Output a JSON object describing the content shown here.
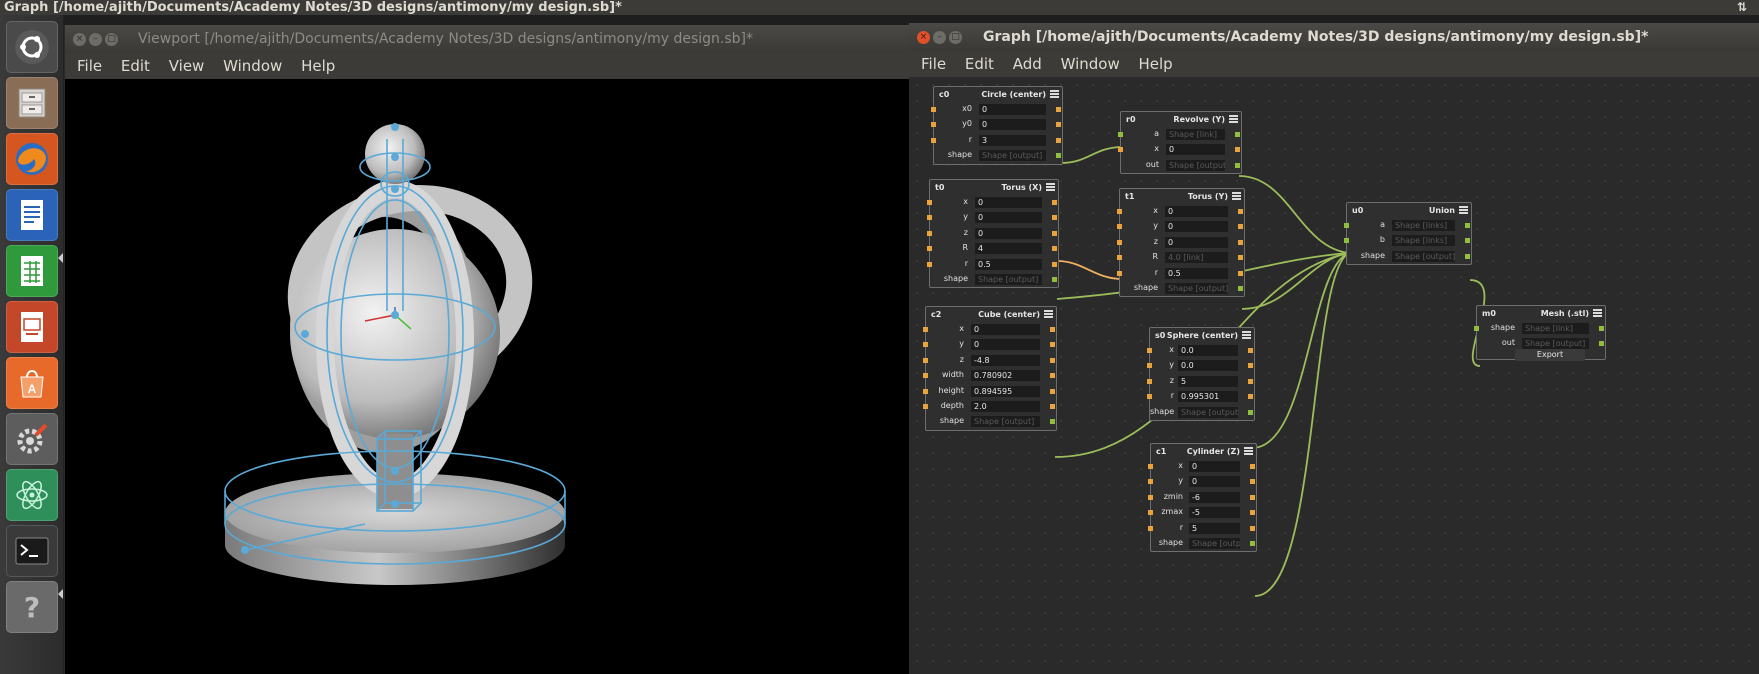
{
  "system_bar": {
    "title": "Graph [/home/ajith/Documents/Academy Notes/3D designs/antimony/my design.sb]*",
    "tray_icon": "sort-updown-icon",
    "tray_glyph": "⇅"
  },
  "launcher": {
    "items": [
      {
        "name": "ubuntu-dash",
        "icon": "ubuntu-logo-icon"
      },
      {
        "name": "files",
        "icon": "file-cabinet-icon"
      },
      {
        "name": "firefox",
        "icon": "firefox-icon"
      },
      {
        "name": "writer",
        "icon": "writer-document-icon"
      },
      {
        "name": "calc",
        "icon": "spreadsheet-icon"
      },
      {
        "name": "impress",
        "icon": "presentation-icon"
      },
      {
        "name": "software-center",
        "icon": "shopping-bag-icon"
      },
      {
        "name": "system-settings",
        "icon": "settings-wrench-icon"
      },
      {
        "name": "atom",
        "icon": "atom-icon"
      },
      {
        "name": "terminal",
        "icon": "terminal-icon"
      },
      {
        "name": "help",
        "icon": "help-icon"
      }
    ]
  },
  "viewport": {
    "title": "Viewport [/home/ajith/Documents/Academy Notes/3D designs/antimony/my design.sb]*",
    "menu": [
      "File",
      "Edit",
      "View",
      "Window",
      "Help"
    ]
  },
  "graph": {
    "title": "Graph [/home/ajith/Documents/Academy Notes/3D designs/antimony/my design.sb]*",
    "menu": [
      "File",
      "Edit",
      "Add",
      "Window",
      "Help"
    ],
    "nodes": {
      "c0": {
        "name": "c0",
        "type": "Circle (center)",
        "rows": [
          {
            "label": "x0",
            "value": "0"
          },
          {
            "label": "y0",
            "value": "0"
          },
          {
            "label": "r",
            "value": "3"
          },
          {
            "label": "shape",
            "value": "Shape [output]"
          }
        ]
      },
      "r0": {
        "name": "r0",
        "type": "Revolve (Y)",
        "rows": [
          {
            "label": "a",
            "value": "Shape [link]"
          },
          {
            "label": "x",
            "value": "0"
          },
          {
            "label": "out",
            "value": "Shape [output]"
          }
        ]
      },
      "t0": {
        "name": "t0",
        "type": "Torus (X)",
        "rows": [
          {
            "label": "x",
            "value": "0"
          },
          {
            "label": "y",
            "value": "0"
          },
          {
            "label": "z",
            "value": "0"
          },
          {
            "label": "R",
            "value": "4"
          },
          {
            "label": "r",
            "value": "0.5"
          },
          {
            "label": "shape",
            "value": "Shape [output]"
          }
        ]
      },
      "t1": {
        "name": "t1",
        "type": "Torus (Y)",
        "rows": [
          {
            "label": "x",
            "value": "0"
          },
          {
            "label": "y",
            "value": "0"
          },
          {
            "label": "z",
            "value": "0"
          },
          {
            "label": "R",
            "value": "4.0 [link]"
          },
          {
            "label": "r",
            "value": "0.5"
          },
          {
            "label": "shape",
            "value": "Shape [output]"
          }
        ]
      },
      "u0": {
        "name": "u0",
        "type": "Union",
        "rows": [
          {
            "label": "a",
            "value": "Shape [links]"
          },
          {
            "label": "b",
            "value": "Shape [links]"
          },
          {
            "label": "shape",
            "value": "Shape [output]"
          }
        ]
      },
      "c2": {
        "name": "c2",
        "type": "Cube (center)",
        "rows": [
          {
            "label": "x",
            "value": "0"
          },
          {
            "label": "y",
            "value": "0"
          },
          {
            "label": "z",
            "value": "-4.8"
          },
          {
            "label": "width",
            "value": "0.780902"
          },
          {
            "label": "height",
            "value": "0.894595"
          },
          {
            "label": "depth",
            "value": "2.0"
          },
          {
            "label": "shape",
            "value": "Shape [output]"
          }
        ]
      },
      "s0": {
        "name": "s0",
        "type": "Sphere (center)",
        "rows": [
          {
            "label": "x",
            "value": "0.0"
          },
          {
            "label": "y",
            "value": "0.0"
          },
          {
            "label": "z",
            "value": "5"
          },
          {
            "label": "r",
            "value": "0.995301"
          },
          {
            "label": "shape",
            "value": "Shape [output]"
          }
        ]
      },
      "m0": {
        "name": "m0",
        "type": "Mesh (.stl)",
        "rows": [
          {
            "label": "shape",
            "value": "Shape [link]"
          },
          {
            "label": "out",
            "value": "Shape [output]"
          }
        ],
        "button": "Export"
      },
      "c1": {
        "name": "c1",
        "type": "Cylinder (Z)",
        "rows": [
          {
            "label": "x",
            "value": "0"
          },
          {
            "label": "y",
            "value": "0"
          },
          {
            "label": "zmin",
            "value": "-6"
          },
          {
            "label": "zmax",
            "value": "-5"
          },
          {
            "label": "r",
            "value": "5"
          },
          {
            "label": "shape",
            "value": "Shape [output]"
          }
        ]
      }
    }
  },
  "colors": {
    "wire_shape": "#9cbd5a",
    "wire_float": "#f0b060",
    "port_float": "#e8a33c",
    "port_shape": "#8fbf3c",
    "wireframe": "#5aa9d6"
  }
}
